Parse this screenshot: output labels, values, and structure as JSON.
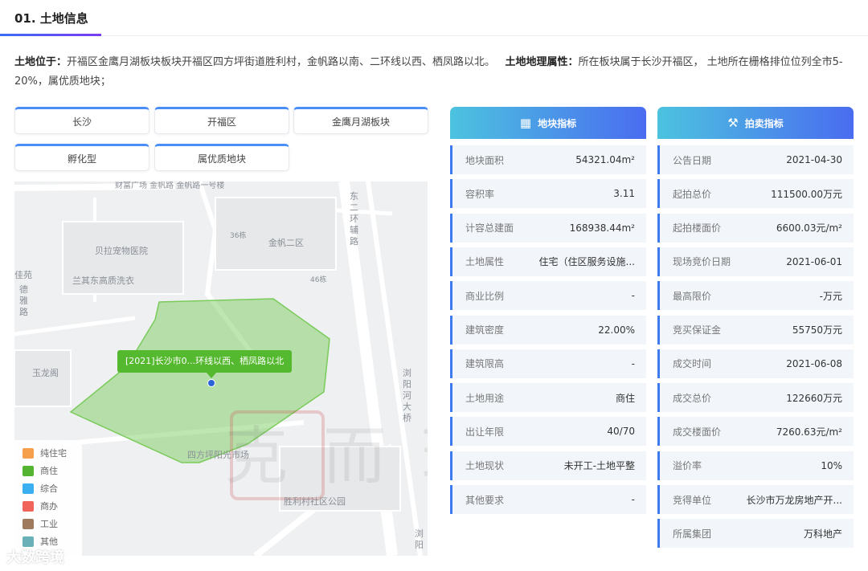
{
  "section": {
    "title": "01. 土地信息"
  },
  "intro": {
    "location_label": "土地位于：",
    "location_text": "开福区金鹰月湖板块板块开福区四方坪街道胜利村，金帆路以南、二环线以西、栖凤路以北。",
    "attr_label": "土地地理属性：",
    "attr_text": "所在板块属于长沙开福区， 土地所在栅格排位位列全市5-20%，属优质地块；"
  },
  "tags": [
    "长沙",
    "开福区",
    "金鹰月湖板块",
    "孵化型",
    "属优质地块"
  ],
  "map": {
    "popup": "[2021]长沙市0...环线以西、栖凤路以北",
    "labels": {
      "l1": "贝拉宠物医院",
      "l2": "兰其东高质洗衣",
      "l3": "金帆二区",
      "l4": "玉龙阁",
      "l5": "四方坪阳光市场",
      "l6": "胜利村社区公园",
      "l7": "36栋",
      "l8": "46栋",
      "l9": "佳苑",
      "v1": "东二环辅路",
      "v2": "浏阳河大桥",
      "v3": "浏阳",
      "v4": "德雅路",
      "top": "财富广场  金帆路  金帆路一号楼"
    },
    "legend": [
      {
        "label": "纯住宅",
        "color": "#f6a04d"
      },
      {
        "label": "商住",
        "color": "#54b432"
      },
      {
        "label": "综合",
        "color": "#3ab0f0"
      },
      {
        "label": "商办",
        "color": "#f0645c"
      },
      {
        "label": "工业",
        "color": "#a07a5c"
      },
      {
        "label": "其他",
        "color": "#6ab0b8"
      }
    ],
    "watermark": "大数跨境",
    "watermark_center": "克而瑞"
  },
  "panel_land": {
    "title": "地块指标",
    "icon": "building-icon",
    "rows": [
      {
        "k": "地块面积",
        "v": "54321.04m²"
      },
      {
        "k": "容积率",
        "v": "3.11"
      },
      {
        "k": "计容总建面",
        "v": "168938.44m²"
      },
      {
        "k": "土地属性",
        "v": "住宅（住区服务设施..."
      },
      {
        "k": "商业比例",
        "v": "-"
      },
      {
        "k": "建筑密度",
        "v": "22.00%"
      },
      {
        "k": "建筑限高",
        "v": "-"
      },
      {
        "k": "土地用途",
        "v": "商住"
      },
      {
        "k": "出让年限",
        "v": "40/70"
      },
      {
        "k": "土地现状",
        "v": "未开工-土地平整"
      },
      {
        "k": "其他要求",
        "v": "-"
      }
    ]
  },
  "panel_auction": {
    "title": "拍卖指标",
    "icon": "gavel-icon",
    "rows": [
      {
        "k": "公告日期",
        "v": "2021-04-30"
      },
      {
        "k": "起拍总价",
        "v": "111500.00万元"
      },
      {
        "k": "起拍楼面价",
        "v": "6600.03元/m²"
      },
      {
        "k": "现场竞价日期",
        "v": "2021-06-01"
      },
      {
        "k": "最高限价",
        "v": "-万元"
      },
      {
        "k": "竞买保证金",
        "v": "55750万元"
      },
      {
        "k": "成交时间",
        "v": "2021-06-08"
      },
      {
        "k": "成交总价",
        "v": "122660万元"
      },
      {
        "k": "成交楼面价",
        "v": "7260.63元/m²"
      },
      {
        "k": "溢价率",
        "v": "10%"
      },
      {
        "k": "竞得单位",
        "v": "长沙市万龙房地产开..."
      },
      {
        "k": "所属集团",
        "v": "万科地产"
      }
    ]
  }
}
